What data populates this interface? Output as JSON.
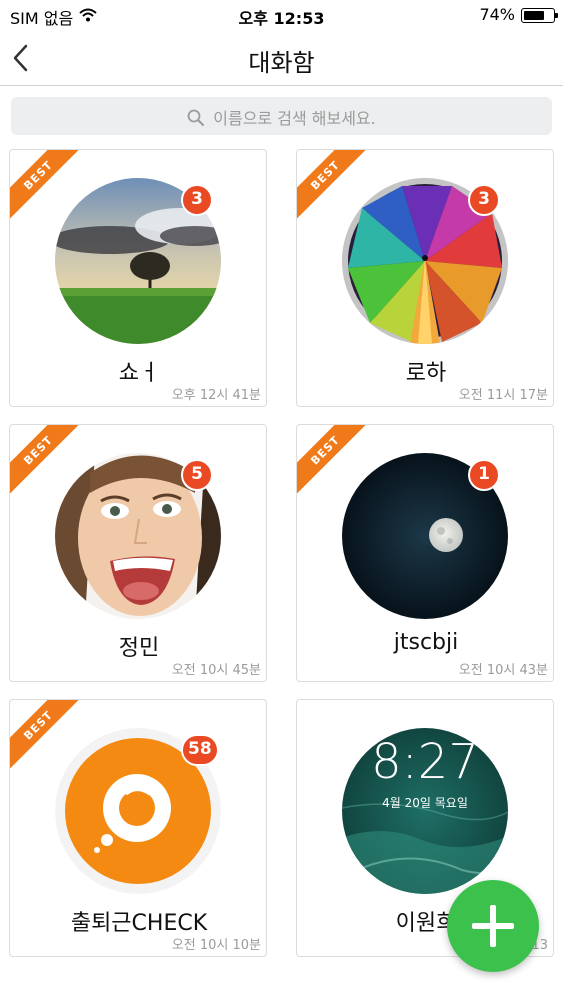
{
  "status_bar": {
    "carrier": "SIM 없음",
    "time": "오후 12:53",
    "battery": "74%",
    "battery_level": 0.74
  },
  "nav": {
    "title": "대화함"
  },
  "search": {
    "placeholder": "이름으로 검색 해보세요."
  },
  "ribbon_label": "BEST",
  "rooms": [
    {
      "name": "쇼ㅓ",
      "time": "오후 12시 41분",
      "unread": "3",
      "best": true,
      "avatar": "landscape-tree"
    },
    {
      "name": "로하",
      "time": "오전 11시 17분",
      "unread": "3",
      "best": true,
      "avatar": "colorful-tunnel"
    },
    {
      "name": "정민",
      "time": "오전 10시 45분",
      "unread": "5",
      "best": true,
      "avatar": "laughing-woman"
    },
    {
      "name": "jtscbji",
      "time": "오전 10시 43분",
      "unread": "1",
      "best": true,
      "avatar": "full-moon"
    },
    {
      "name": "출퇴근CHECK",
      "time": "오전 10시 10분",
      "unread": "58",
      "best": true,
      "avatar": "check-logo"
    },
    {
      "name": "이원희",
      "time": "13",
      "unread": "",
      "best": false,
      "avatar": "lockscreen",
      "lock_time": "8:27",
      "lock_date": "4월 20일 목요일"
    }
  ],
  "colors": {
    "accent_orange": "#f07a1a",
    "badge_red": "#ea4a23",
    "fab_green": "#3cc24c"
  }
}
